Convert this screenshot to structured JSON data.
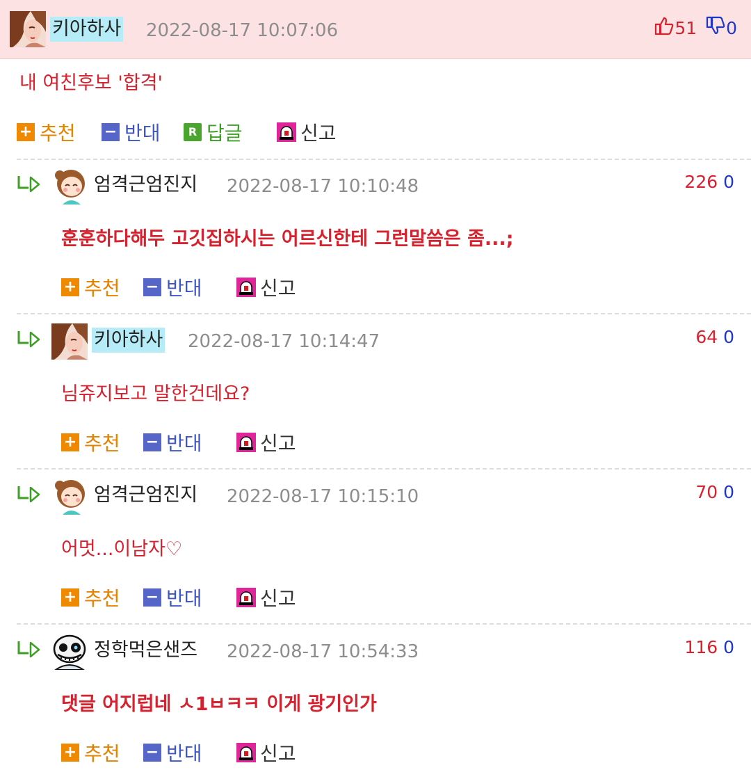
{
  "post": {
    "author": "키아하사",
    "timestamp": "2022-08-17 10:07:06",
    "likes": "51",
    "dislikes": "0",
    "text": "내 여친후보 '합격'",
    "actions": {
      "recommend": "추천",
      "oppose": "반대",
      "reply": "답글",
      "report": "신고"
    }
  },
  "replies": [
    {
      "author": "엄격근엄진지",
      "timestamp": "2022-08-17 10:10:48",
      "likes": "226",
      "dislikes": "0",
      "text": "훈훈하다해두 고깃집하시는 어르신한테 그런말씀은 좀...;"
    },
    {
      "author": "키아하사",
      "timestamp": "2022-08-17 10:14:47",
      "likes": "64",
      "dislikes": "0",
      "text": "님쥬지보고 말한건데요?"
    },
    {
      "author": "엄격근엄진지",
      "timestamp": "2022-08-17 10:15:10",
      "likes": "70",
      "dislikes": "0",
      "text": "어멋...이남자♡"
    },
    {
      "author": "정학먹은샌즈",
      "timestamp": "2022-08-17 10:54:33",
      "likes": "116",
      "dislikes": "0",
      "text": "댓글 어지럽네 ㅅ1ㅂㅋㅋ 이게 광기인가"
    }
  ],
  "reply_actions": {
    "recommend": "추천",
    "oppose": "반대",
    "report": "신고"
  },
  "colors": {
    "header_bg": "#fde2e4",
    "like": "#d6222e",
    "dislike": "#1f37c5",
    "recommend": "#ef8a00",
    "oppose": "#5566c8",
    "reply": "#4aa52d"
  },
  "icons": [
    "thumbs-up-icon",
    "thumbs-down-icon",
    "reply-arrow-icon",
    "plus-icon",
    "minus-icon",
    "reply-r-icon",
    "siren-icon"
  ]
}
